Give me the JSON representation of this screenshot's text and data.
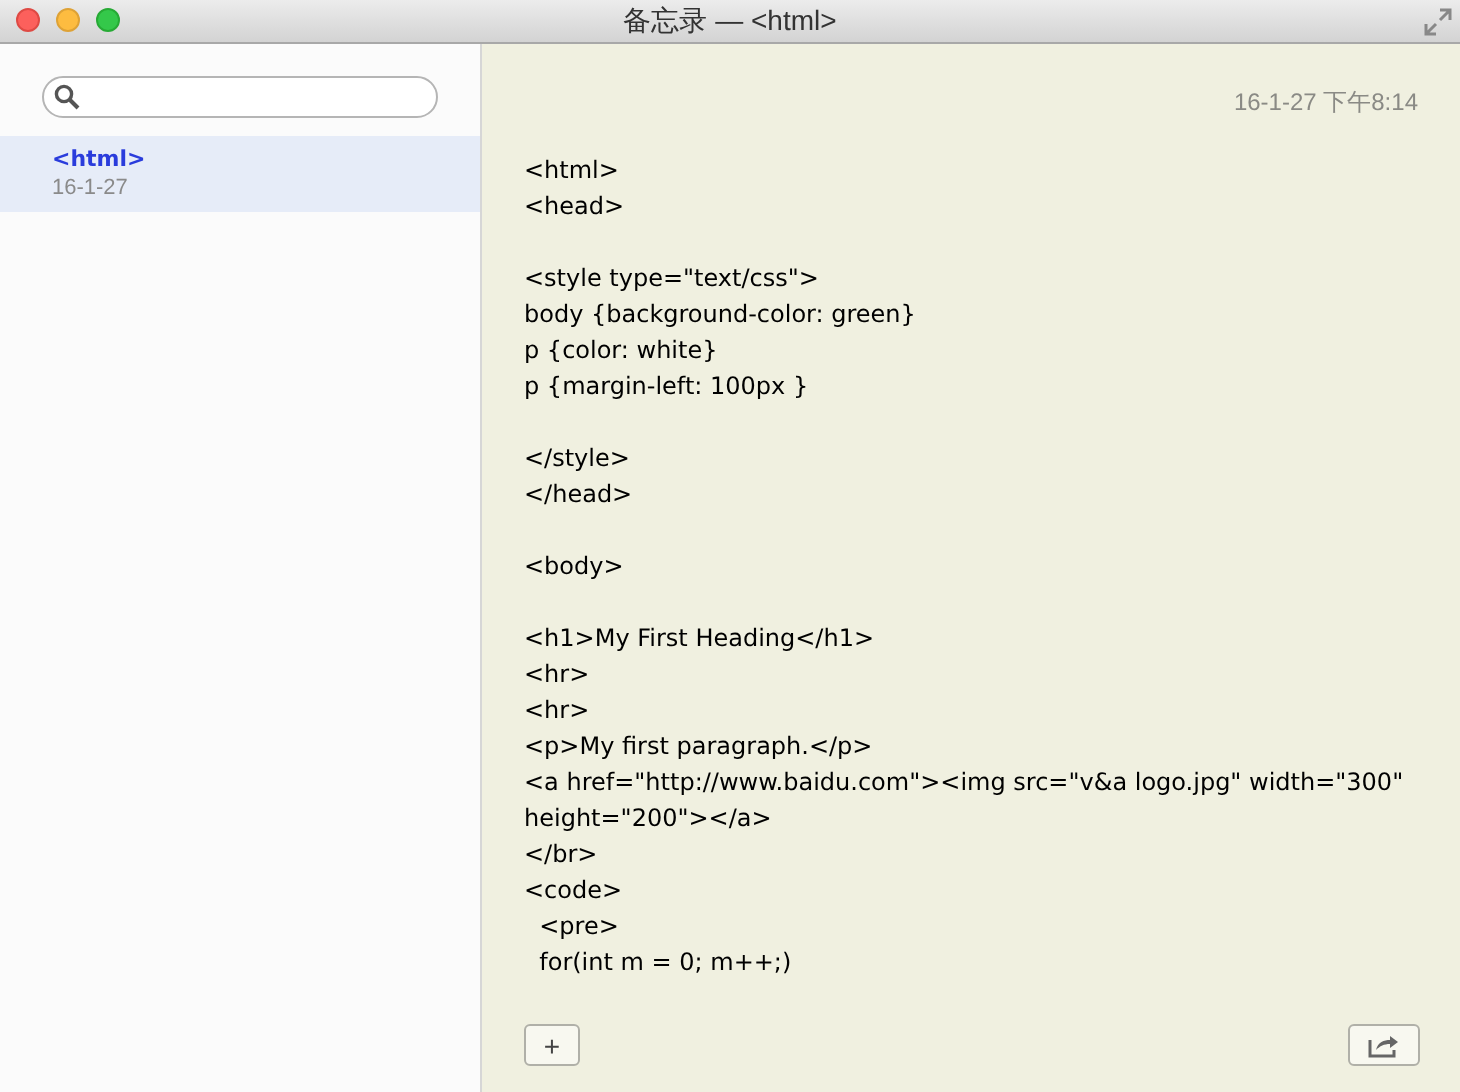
{
  "window": {
    "title": "备忘录 — <html>"
  },
  "sidebar": {
    "notes": [
      {
        "title": "<html>",
        "date": "16-1-27",
        "selected": true
      }
    ]
  },
  "note": {
    "timestamp": "16-1-27 下午8:14",
    "blocks": [
      [
        "<html>",
        "<head>"
      ],
      [
        "<style type=\"text/css\">",
        "body {background-color: green}",
        "p {color: white}",
        "p {margin-left: 100px }"
      ],
      [
        "</style>",
        "</head>"
      ],
      [
        "<body>"
      ],
      [
        "<h1>My First Heading</h1>",
        "<hr>",
        "<hr>",
        "<p>My first paragraph.</p>",
        "<a href=\"http://www.baidu.com\"><img src=\"v&a logo.jpg\" width=\"300\"",
        "height=\"200\"></a>",
        "</br>",
        "<code>",
        "  <pre>",
        "  for(int m = 0; m++;)"
      ]
    ]
  },
  "toolbar": {
    "add_button": "+"
  }
}
